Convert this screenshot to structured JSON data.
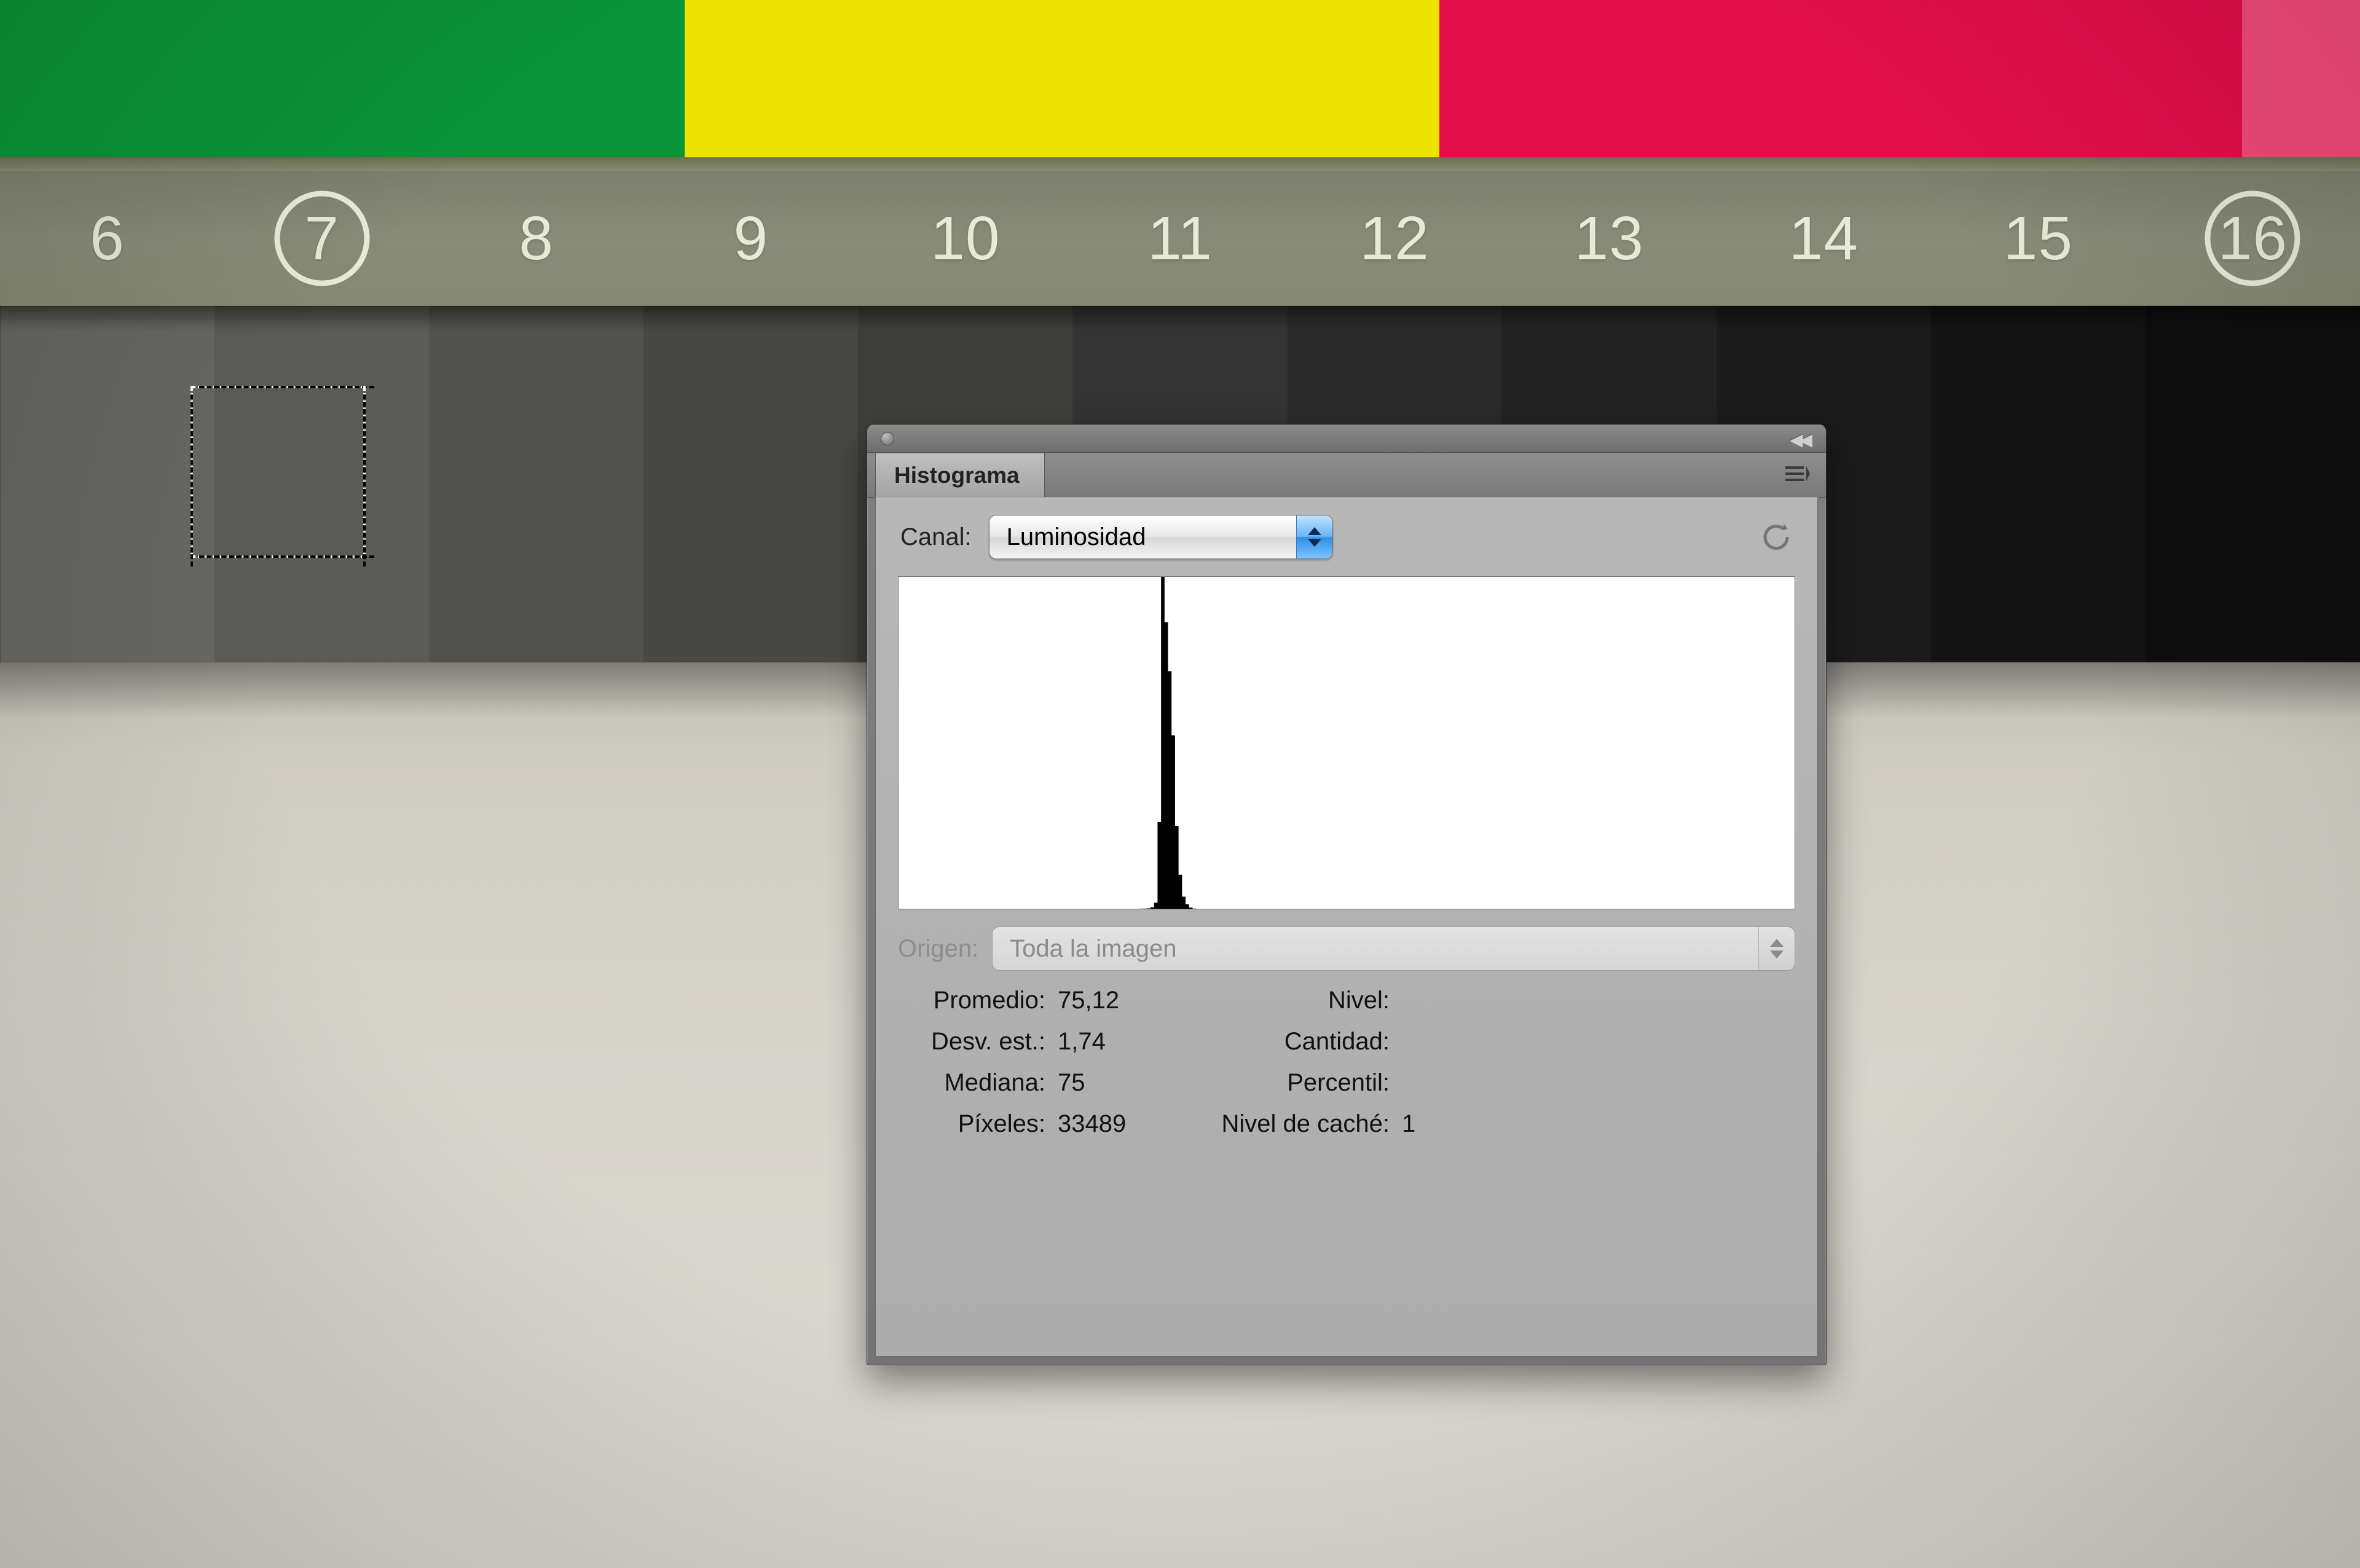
{
  "ruler": {
    "cells": [
      {
        "label": "6",
        "circled": false
      },
      {
        "label": "7",
        "circled": true
      },
      {
        "label": "8",
        "circled": false
      },
      {
        "label": "9",
        "circled": false
      },
      {
        "label": "10",
        "circled": false
      },
      {
        "label": "11",
        "circled": false
      },
      {
        "label": "12",
        "circled": false
      },
      {
        "label": "13",
        "circled": false
      },
      {
        "label": "14",
        "circled": false
      },
      {
        "label": "15",
        "circled": false
      },
      {
        "label": "16",
        "circled": true
      }
    ]
  },
  "panel": {
    "tab_label": "Histograma",
    "channel_label": "Canal:",
    "channel_value": "Luminosidad",
    "origin_label": "Origen:",
    "origin_value": "Toda la imagen",
    "stats": {
      "mean_label": "Promedio:",
      "mean_value": "75,12",
      "stddev_label": "Desv. est.:",
      "stddev_value": "1,74",
      "median_label": "Mediana:",
      "median_value": "75",
      "pixels_label": "Píxeles:",
      "pixels_value": "33489",
      "level_label": "Nivel:",
      "level_value": "",
      "count_label": "Cantidad:",
      "count_value": "",
      "percent_label": "Percentil:",
      "percent_value": "",
      "cache_label": "Nivel de caché:",
      "cache_value": "1"
    }
  },
  "chart_data": {
    "type": "bar",
    "title": "Histograma",
    "xlabel": "Luminosidad",
    "ylabel": "",
    "xlim": [
      0,
      255
    ],
    "mean": 75.12,
    "stddev": 1.74,
    "median": 75,
    "pixels": 33489,
    "series": [
      {
        "name": "Luminosidad",
        "x": [
          68,
          69,
          70,
          71,
          72,
          73,
          74,
          75,
          76,
          77,
          78,
          79,
          80,
          81,
          82,
          83,
          84
        ],
        "values": [
          1,
          2,
          4,
          10,
          40,
          160,
          2300,
          8800,
          7600,
          6300,
          4600,
          2200,
          900,
          320,
          120,
          30,
          4
        ]
      }
    ]
  }
}
